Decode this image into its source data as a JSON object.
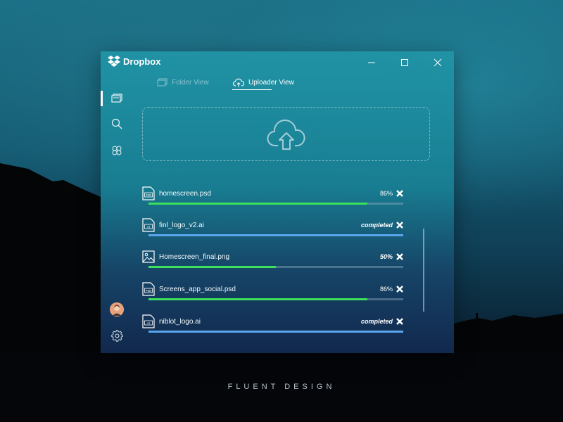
{
  "app": {
    "brand": "Dropbox"
  },
  "window_controls": {
    "minimize_icon": "minimize-icon",
    "maximize_icon": "maximize-icon",
    "close_icon": "close-icon"
  },
  "sidebar": {
    "items": [
      {
        "icon": "folders-icon",
        "active": true
      },
      {
        "icon": "search-icon",
        "active": false
      },
      {
        "icon": "sharing-icon",
        "active": false
      }
    ],
    "bottom": [
      {
        "icon": "avatar"
      },
      {
        "icon": "gear-icon"
      }
    ]
  },
  "tabs": [
    {
      "label": "Folder View",
      "icon": "folder-view-icon",
      "active": false
    },
    {
      "label": "Uploader View",
      "icon": "cloud-upload-icon",
      "active": true
    }
  ],
  "dropzone": {
    "icon": "cloud-upload-icon"
  },
  "files": [
    {
      "name": "homescreen.psd",
      "type": "PSD",
      "status": "86%",
      "progress": 0.86,
      "state": "uploading"
    },
    {
      "name": "finl_logo_v2.ai",
      "type": "AI",
      "status": "completed",
      "progress": 1.0,
      "state": "completed"
    },
    {
      "name": "Homescreen_final.png",
      "type": "image",
      "status": "50%",
      "progress": 0.5,
      "state": "uploading"
    },
    {
      "name": "Screens_app_social.psd",
      "type": "PSD",
      "status": "86%",
      "progress": 0.86,
      "state": "uploading"
    },
    {
      "name": "niblot_logo.ai",
      "type": "AI",
      "status": "completed",
      "progress": 1.0,
      "state": "completed"
    }
  ],
  "caption": "FLUENT DESIGN",
  "colors": {
    "progress_active": "#3de05c",
    "progress_complete": "#5aa6ee",
    "accent": "#2094a6"
  }
}
